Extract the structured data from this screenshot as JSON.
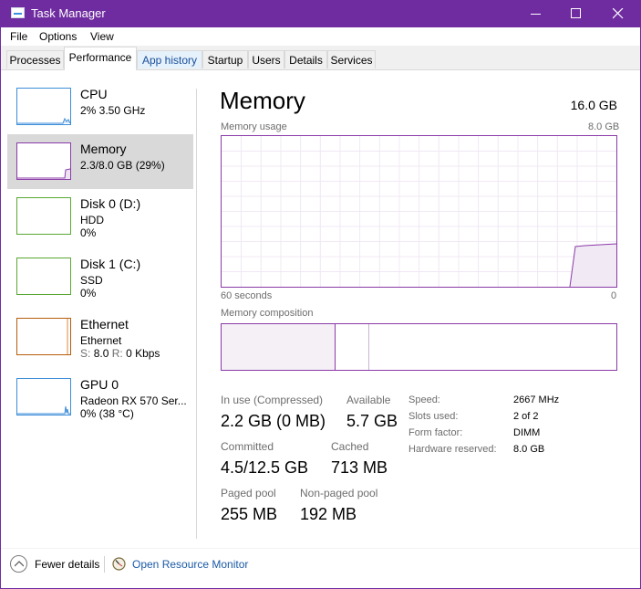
{
  "window": {
    "title": "Task Manager"
  },
  "menu": [
    "File",
    "Options",
    "View"
  ],
  "tabs": [
    "Processes",
    "Performance",
    "App history",
    "Startup",
    "Users",
    "Details",
    "Services"
  ],
  "sidebar": [
    {
      "title": "CPU",
      "line1": "2% 3.50 GHz",
      "line2": ""
    },
    {
      "title": "Memory",
      "line1": "2.3/8.0 GB (29%)",
      "line2": ""
    },
    {
      "title": "Disk 0 (D:)",
      "line1": "HDD",
      "line2": "0%"
    },
    {
      "title": "Disk 1 (C:)",
      "line1": "SSD",
      "line2": "0%"
    },
    {
      "title": "Ethernet",
      "line1": "Ethernet",
      "line2_s": "S:",
      "line2_s_val": "8.0",
      "line2_r": "R:",
      "line2_r_val": "0 Kbps"
    },
    {
      "title": "GPU 0",
      "line1": "Radeon RX 570 Ser...",
      "line2": "0% (38 °C)"
    }
  ],
  "memory": {
    "heading": "Memory",
    "total": "16.0 GB",
    "usage_label": "Memory usage",
    "usage_max": "8.0 GB",
    "axis_left": "60 seconds",
    "axis_right": "0",
    "composition_label": "Memory composition",
    "stats": {
      "in_use_label": "In use (Compressed)",
      "in_use_value": "2.2 GB (0 MB)",
      "available_label": "Available",
      "available_value": "5.7 GB",
      "committed_label": "Committed",
      "committed_value": "4.5/12.5 GB",
      "cached_label": "Cached",
      "cached_value": "713 MB",
      "paged_label": "Paged pool",
      "paged_value": "255 MB",
      "nonpaged_label": "Non-paged pool",
      "nonpaged_value": "192 MB"
    },
    "specs": [
      {
        "label": "Speed:",
        "value": "2667 MHz"
      },
      {
        "label": "Slots used:",
        "value": "2 of 2"
      },
      {
        "label": "Form factor:",
        "value": "DIMM"
      },
      {
        "label": "Hardware reserved:",
        "value": "8.0 GB"
      }
    ]
  },
  "footer": {
    "fewer_details": "Fewer details",
    "resource_monitor": "Open Resource Monitor"
  },
  "colors": {
    "accent": "#6f2ca0",
    "memory": "#8b3aa8",
    "cpu": "#3c8dd8",
    "disk": "#5aa832",
    "ethernet": "#b85d0c",
    "link": "#1a5aa6"
  },
  "icons": [
    "app-icon",
    "minimize-icon",
    "maximize-icon",
    "close-icon",
    "chevron-up-icon",
    "resource-monitor-icon"
  ]
}
